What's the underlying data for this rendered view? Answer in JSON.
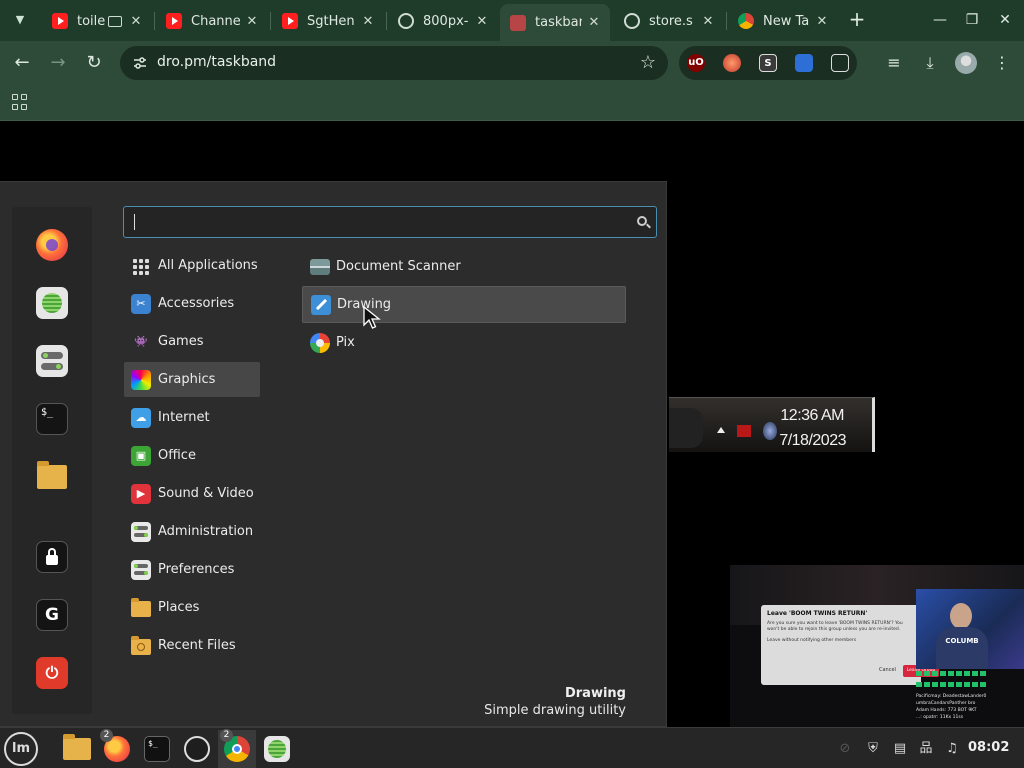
{
  "browser": {
    "tabs": [
      {
        "title": "toile",
        "favicon": "youtube-icon",
        "active": false
      },
      {
        "title": "Channe",
        "favicon": "youtube-icon",
        "active": false
      },
      {
        "title": "SgtHen",
        "favicon": "youtube-icon",
        "active": false
      },
      {
        "title": "800px-",
        "favicon": "globe-icon",
        "active": false
      },
      {
        "title": "taskban",
        "favicon": "taskband-icon",
        "active": true
      },
      {
        "title": "store.s",
        "favicon": "globe-icon",
        "active": false
      },
      {
        "title": "New Ta",
        "favicon": "chrome-icon",
        "active": false
      }
    ],
    "close_glyph": "✕",
    "url": "dro.pm/taskband",
    "extension_labels": {
      "ublock": "uO",
      "s": "S"
    }
  },
  "page": {
    "clock_time": "12:36 AM",
    "clock_date": "7/18/2023",
    "stream": {
      "dialog_title": "Leave 'BOOM TWINS RETURN'",
      "dialog_body": "Are you sure you want to leave 'BOOM TWINS RETURN'? You won't be able to rejoin this group unless you are re-invited.",
      "dialog_check": "Leave without notifying other members",
      "dialog_cancel": "Cancel",
      "dialog_confirm": "Leave Group",
      "shirt_text": "COLUMB",
      "chat": [
        "Pacificmay: DeadestawLander0",
        "umbraCandarsPanther bro",
        "Adam Hands: 773 BOT 9KT",
        "...: opatrr: 11Kx 11ss"
      ]
    }
  },
  "menu": {
    "search": {
      "value": "",
      "placeholder": ""
    },
    "favorites": [
      {
        "name": "firefox",
        "icon": "firefox-icon"
      },
      {
        "name": "software-manager",
        "icon": "software-manager-icon"
      },
      {
        "name": "system-settings",
        "icon": "settings-toggle-icon"
      },
      {
        "name": "terminal",
        "icon": "terminal-icon",
        "glyph": "$_"
      },
      {
        "name": "files",
        "icon": "folder-icon"
      },
      {
        "name": "lock-screen",
        "icon": "lock-icon"
      },
      {
        "name": "logout",
        "icon": "logout-icon",
        "glyph": "G"
      },
      {
        "name": "shutdown",
        "icon": "power-icon",
        "glyph": "⏻"
      }
    ],
    "categories": [
      {
        "label": "All Applications",
        "icon": "grid-icon"
      },
      {
        "label": "Accessories",
        "icon": "scissors-icon"
      },
      {
        "label": "Games",
        "icon": "gamepad-icon"
      },
      {
        "label": "Graphics",
        "icon": "graphics-icon",
        "selected": true
      },
      {
        "label": "Internet",
        "icon": "cloud-icon"
      },
      {
        "label": "Office",
        "icon": "office-icon"
      },
      {
        "label": "Sound & Video",
        "icon": "play-icon"
      },
      {
        "label": "Administration",
        "icon": "admin-icon"
      },
      {
        "label": "Preferences",
        "icon": "preferences-icon"
      },
      {
        "label": "Places",
        "icon": "folder-icon"
      },
      {
        "label": "Recent Files",
        "icon": "recent-folder-icon"
      }
    ],
    "apps": [
      {
        "label": "Document Scanner",
        "icon": "scanner-icon"
      },
      {
        "label": "Drawing",
        "icon": "drawing-icon",
        "hovered": true
      },
      {
        "label": "Pix",
        "icon": "pix-icon"
      }
    ],
    "description": {
      "title": "Drawing",
      "text": "Simple drawing utility"
    }
  },
  "panel": {
    "menu_glyph": "lm",
    "launchers": [
      {
        "name": "files",
        "icon": "folder-icon"
      },
      {
        "name": "firefox",
        "icon": "firefox-icon",
        "badge": "2"
      },
      {
        "name": "terminal",
        "icon": "terminal-icon",
        "glyph": "$_"
      },
      {
        "name": "obs",
        "icon": "obs-icon"
      },
      {
        "name": "chrome",
        "icon": "chrome-icon",
        "badge": "2"
      },
      {
        "name": "software-manager",
        "icon": "software-manager-icon"
      }
    ],
    "clock": "08:02"
  },
  "colors": {
    "chrome_dark": "#1f3b2a",
    "chrome_toolbar": "#2e4a38",
    "menu_bg": "#2c2c2c",
    "search_focus": "#4b8fb0",
    "panel_bg": "#262626"
  }
}
